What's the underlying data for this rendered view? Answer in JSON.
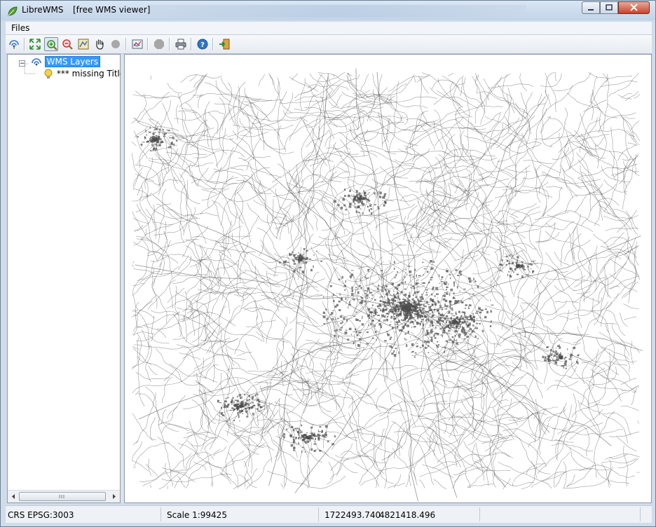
{
  "window": {
    "app_name": "LibreWMS",
    "subtitle": "[free WMS viewer]"
  },
  "menubar": {
    "items": [
      {
        "label": "Files"
      }
    ]
  },
  "toolbar": {
    "buttons": [
      {
        "name": "wms-connect-icon"
      },
      {
        "name": "zoom-full-extent-icon"
      },
      {
        "name": "zoom-in-icon",
        "active": true
      },
      {
        "name": "zoom-out-icon"
      },
      {
        "name": "zoom-to-layer-icon"
      },
      {
        "name": "pan-hand-icon"
      },
      {
        "name": "disabled-tool-icon"
      },
      {
        "name": "map-refresh-icon"
      },
      {
        "name": "stop-icon"
      },
      {
        "name": "print-icon"
      },
      {
        "name": "help-icon"
      },
      {
        "name": "exit-icon"
      }
    ]
  },
  "tree": {
    "root_label": "WMS Layers",
    "layers": [
      {
        "label": "*** missing Title"
      }
    ]
  },
  "statusbar": {
    "crs": "CRS EPSG:3003",
    "scale": "Scale 1:99425",
    "x": "1722493.740",
    "y": "4821418.496"
  },
  "colors": {
    "selection": "#3399ff",
    "map_background": "#ffffff",
    "map_features": "#4d4d4d",
    "close_button": "#c7432a"
  }
}
